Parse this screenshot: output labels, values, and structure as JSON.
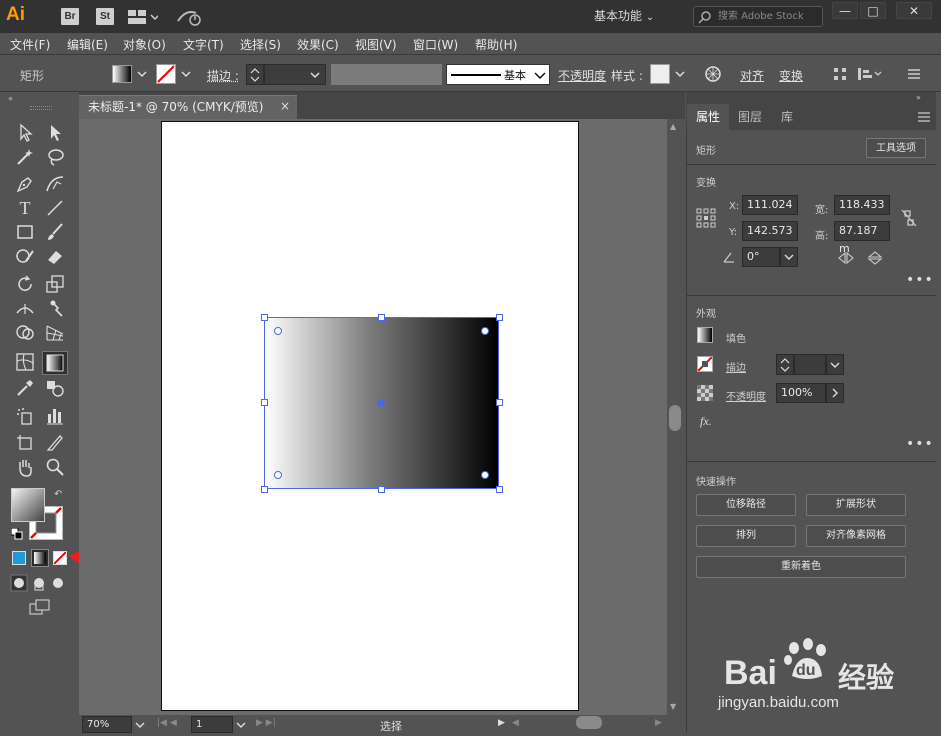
{
  "titlebar": {
    "app_logo": "Ai",
    "badges": [
      "Br",
      "St"
    ],
    "workspace": "基本功能",
    "stock_search_placeholder": "搜索 Adobe Stock",
    "window_buttons": [
      "—",
      "□",
      "✕"
    ]
  },
  "menu": [
    "文件(F)",
    "编辑(E)",
    "对象(O)",
    "文字(T)",
    "选择(S)",
    "效果(C)",
    "视图(V)",
    "窗口(W)",
    "帮助(H)"
  ],
  "control": {
    "selection_type": "矩形",
    "stroke_label": "描边 :",
    "stroke_profile": "基本",
    "opacity_label": "不透明度",
    "style_label": "样式 :",
    "align_label": "对齐",
    "transform_label": "变换"
  },
  "document": {
    "tab_title": "未标题-1* @ 70% (CMYK/预览)",
    "tab_close": "×",
    "gradient_colors": [
      "#ffffff",
      "#7c7c7c",
      "#000000"
    ]
  },
  "status": {
    "zoom": "70%",
    "page": "1",
    "tool": "选择"
  },
  "panel": {
    "tabs": [
      "属性",
      "图层",
      "库"
    ],
    "object_type": "矩形",
    "tool_options_button": "工具选项",
    "transform_title": "变换",
    "x_label": "X:",
    "x_value": "111.024",
    "y_label": "Y:",
    "y_value": "142.573",
    "w_label": "宽:",
    "w_value": "118.433",
    "h_label": "高:",
    "h_value": "87.187 m",
    "angle_value": "0°",
    "appearance_title": "外观",
    "fill_label": "填色",
    "stroke_label": "描边",
    "opacity_label": "不透明度",
    "opacity_value": "100%",
    "fx_label": "fx.",
    "quick_actions_title": "快速操作",
    "quick_actions": [
      "位移路径",
      "扩展形状",
      "排列",
      "对齐像素网格",
      "重新着色"
    ]
  },
  "watermark": {
    "brand": "Bai",
    "brand2": "du",
    "brand_cn": "经验",
    "url": "jingyan.baidu.com"
  }
}
